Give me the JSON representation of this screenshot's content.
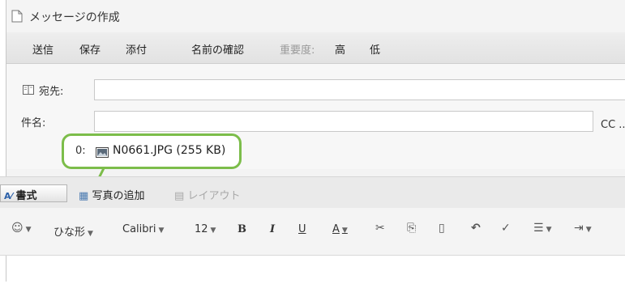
{
  "window": {
    "title": "メッセージの作成"
  },
  "toolbar": {
    "send": "送信",
    "save": "保存",
    "attach": "添付",
    "check_names": "名前の確認",
    "importance_label": "重要度:",
    "importance_high": "高",
    "importance_low": "低"
  },
  "fields": {
    "to_label": "宛先:",
    "subject_label": "件名:",
    "cc_label": "CC ..",
    "attachment_label": "0:",
    "attachment_file": "N0661.JPG (255 KB)"
  },
  "format_toolbar": {
    "format_button": "書式",
    "add_photo": "写真の追加",
    "layout": "レイアウト"
  },
  "editor_toolbar": {
    "emoji_icon": "smiley-icon",
    "template": "ひな形",
    "font": "Calibri",
    "font_size": "12",
    "bold": "B",
    "italic": "I",
    "underline": "U",
    "font_color": "A",
    "cut_glyph": "✂",
    "copy_glyph": "⎘",
    "paste_glyph": "📋",
    "undo_glyph": "↶",
    "spell_glyph": "✓",
    "list_glyph": "☰",
    "indent_glyph": "⇥"
  },
  "colors": {
    "callout_green": "#7cbd4a"
  }
}
